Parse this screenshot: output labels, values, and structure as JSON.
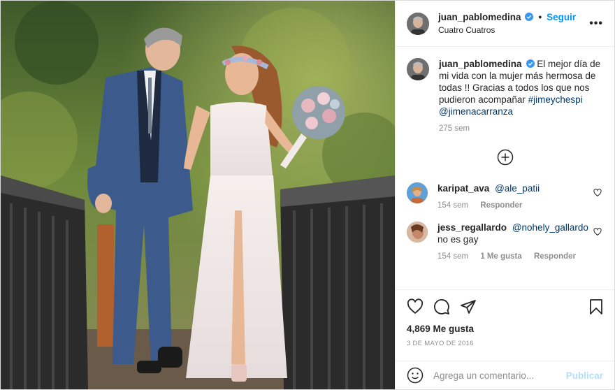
{
  "post": {
    "author": "juan_pablomedina",
    "follow_label": "Seguir",
    "location": "Cuatro Cuatros",
    "more_label": "•••",
    "photo_description_icon": "wedding-photo"
  },
  "caption": {
    "author": "juan_pablomedina",
    "text": "El mejor día de mi vida con la mujer más hermosa de todas !! Gracias a todos los que nos pudieron acompañar",
    "hashtag": "#jimeychespi",
    "mention": "@jimenacarranza",
    "time": "275 sem"
  },
  "comments": [
    {
      "author": "karipat_ava",
      "mention": "@ale_patii",
      "text": "",
      "time": "154 sem",
      "likes": "",
      "reply_label": "Responder"
    },
    {
      "author": "jess_regallardo",
      "mention": "@nohely_gallardo",
      "text": "no es gay",
      "time": "154 sem",
      "likes": "1 Me gusta",
      "reply_label": "Responder"
    }
  ],
  "actions": {
    "likes": "4,869 Me gusta",
    "date": "3 DE MAYO DE 2016"
  },
  "add_comment": {
    "placeholder": "Agrega un comentario...",
    "publish_label": "Publicar"
  },
  "colors": {
    "accent": "#0095f6",
    "link": "#00376b",
    "muted": "#8e8e8e",
    "publish_disabled": "#b2dffc"
  }
}
